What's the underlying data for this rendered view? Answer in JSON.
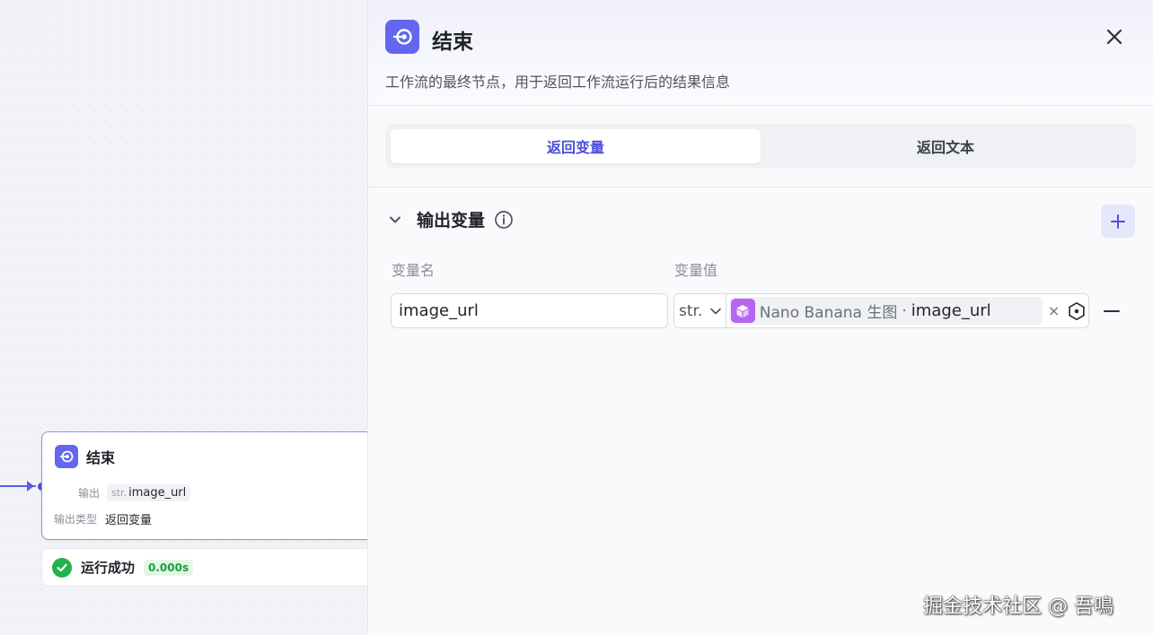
{
  "node": {
    "title": "结束",
    "output_key": "输出",
    "output_type_prefix": "str.",
    "output_value": "image_url",
    "output_kind_key": "输出类型",
    "output_kind_value": "返回变量"
  },
  "run_status": {
    "text": "运行成功",
    "duration": "0.000s"
  },
  "panel": {
    "title": "结束",
    "description": "工作流的最终节点，用于返回工作流运行后的结果信息",
    "tabs": [
      {
        "label": "返回变量",
        "active": true
      },
      {
        "label": "返回文本",
        "active": false
      }
    ],
    "section_title": "输出变量",
    "col_name_label": "变量名",
    "col_value_label": "变量值",
    "variables": [
      {
        "name": "image_url",
        "type": "str.",
        "ref_node": "Nano Banana 生图",
        "ref_separator": "·",
        "ref_var": "image_url",
        "remove_symbol": "×"
      }
    ]
  },
  "watermark": "掘金技术社区 @ 吾鳴",
  "colors": {
    "accent": "#6366f1",
    "success": "#22b34b",
    "plugin_icon": "#b665f2"
  }
}
